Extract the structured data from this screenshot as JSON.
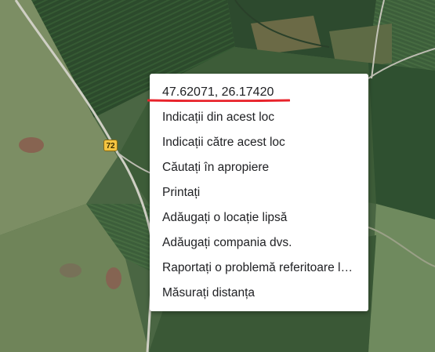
{
  "map": {
    "route_shield": "72",
    "colors": {
      "field_dark": "#2f4a2e",
      "field_mid": "#4f6b45",
      "field_light": "#8a9a6c",
      "road": "#c9c9c0",
      "annotation_red": "#e8232b"
    }
  },
  "context_menu": {
    "coordinates": "47.62071, 26.17420",
    "items": [
      {
        "label": "Indicații din acest loc"
      },
      {
        "label": "Indicații către acest loc"
      },
      {
        "label": "Căutați în apropiere"
      },
      {
        "label": "Printați"
      },
      {
        "label": "Adăugați o locație lipsă"
      },
      {
        "label": "Adăugați compania dvs."
      },
      {
        "label": "Raportați o problemă referitoare la date"
      },
      {
        "label": "Măsurați distanța"
      }
    ]
  }
}
